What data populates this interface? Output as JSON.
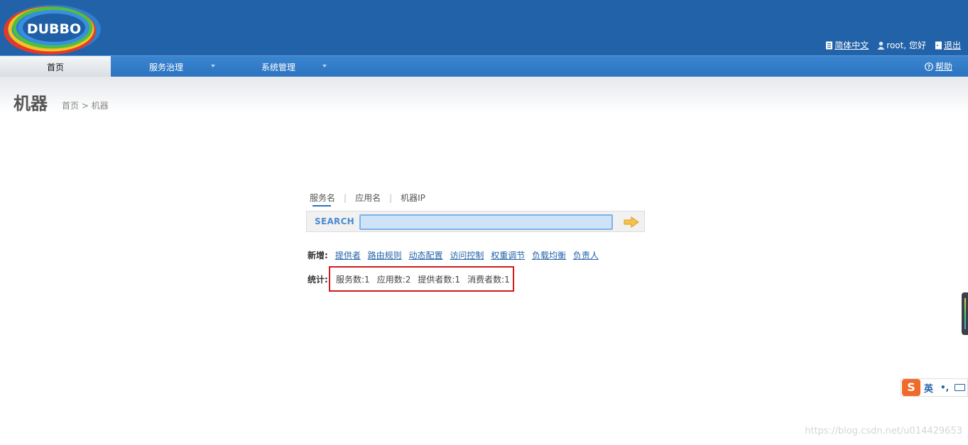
{
  "header": {
    "logo_text": "DUBBO",
    "language_link": "简体中文",
    "user_greeting": "root, 您好",
    "logout_link": "退出"
  },
  "nav": {
    "home": "首页",
    "service_governance": "服务治理",
    "system_management": "系统管理",
    "help": "帮助"
  },
  "page": {
    "title": "机器",
    "breadcrumb": "首页 > 机器"
  },
  "search": {
    "tabs": [
      "服务名",
      "应用名",
      "机器IP"
    ],
    "label": "SEARCH",
    "value": ""
  },
  "add_row": {
    "label": "新增:",
    "links": [
      "提供者",
      "路由规则",
      "动态配置",
      "访问控制",
      "权重调节",
      "负载均衡",
      "负责人"
    ]
  },
  "stats_row": {
    "label": "统计:",
    "items": [
      "服务数:1",
      "应用数:2",
      "提供者数:1",
      "消费者数:1"
    ]
  },
  "ime": {
    "logo": "S",
    "language": "英",
    "punctuation": "•,"
  },
  "watermark": "https://blog.csdn.net/u014429653",
  "colors": {
    "header_bg": "#2262a8",
    "nav_bg": "#2b73c0",
    "link": "#2262a8",
    "highlight_border": "#d11b1b"
  }
}
